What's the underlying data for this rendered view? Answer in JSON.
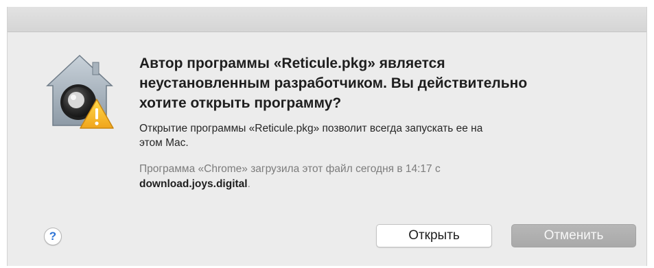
{
  "dialog": {
    "icon": "gatekeeper-warning-icon",
    "headline": "Автор программы «Reticule.pkg» является\nнеустановленным разработчиком. Вы действительно\nхотите открыть программу?",
    "informative": "Открытие программы «Reticule.pkg» позволит всегда запускать ее на\nэтом Mac.",
    "origin_prefix": "Программа «Chrome» загрузила этот файл сегодня в 14:17 с",
    "origin_domain": "download.joys.digital",
    "origin_suffix": ".",
    "help_label": "?",
    "open_label": "Открыть",
    "cancel_label": "Отменить"
  },
  "colors": {
    "window_bg": "#ececec",
    "cancel_button": "#adadad",
    "help_blue": "#2c73d6",
    "warning_yellow": "#f5c230"
  }
}
